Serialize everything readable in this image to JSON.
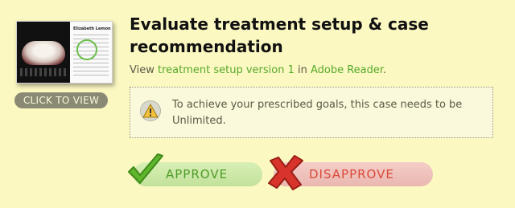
{
  "thumbnail": {
    "patient_name": "Elizabeth Lemon",
    "click_label": "CLICK TO VIEW"
  },
  "header": {
    "title": "Evaluate treatment setup & case recommendation"
  },
  "view_line": {
    "prefix": "View ",
    "setup_link": "treatment setup version 1",
    "middle": " in ",
    "reader_link": "Adobe Reader",
    "suffix": "."
  },
  "alert": {
    "icon": "warning-icon",
    "message": "To achieve your prescribed goals, this case needs to be Unlimited."
  },
  "actions": {
    "approve_label": "APPROVE",
    "disapprove_label": "DISAPPROVE"
  },
  "colors": {
    "background": "#fbf8c1",
    "link": "#58a92a",
    "approve": "#4d9b2a",
    "disapprove": "#d94a3a"
  }
}
